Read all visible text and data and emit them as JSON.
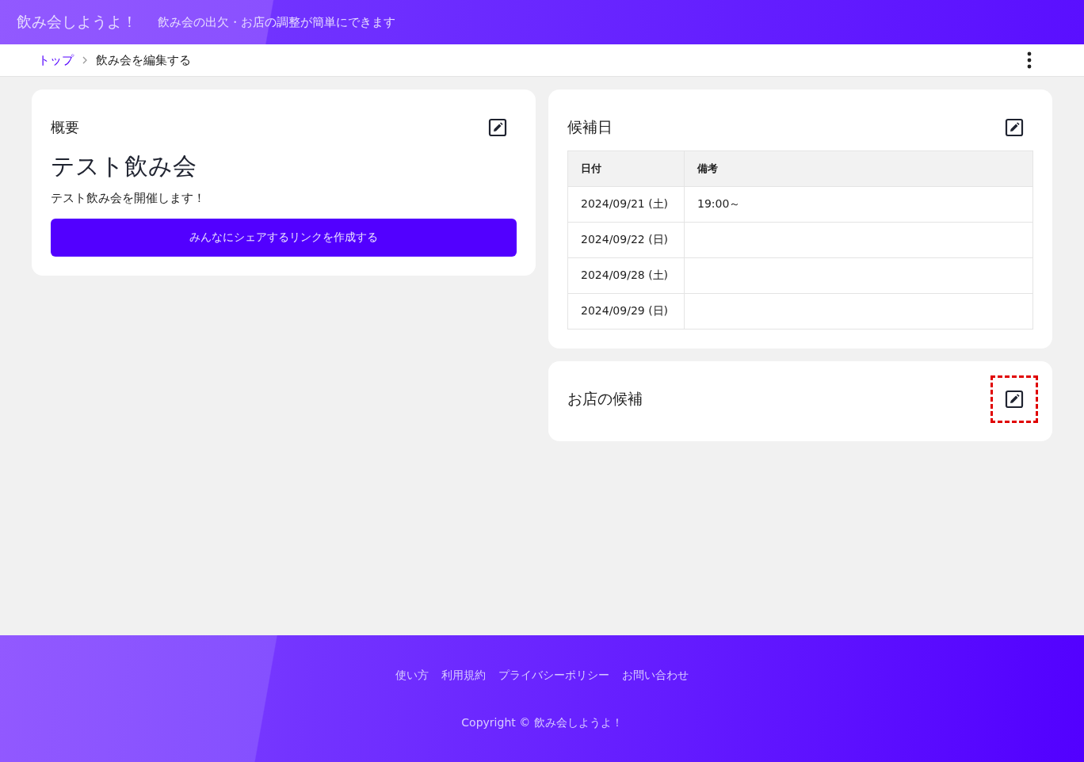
{
  "header": {
    "logo": "飲み会しようよ！",
    "tagline": "飲み会の出欠・お店の調整が簡単にできます"
  },
  "breadcrumb": [
    {
      "label": "トップ",
      "link": true
    },
    {
      "label": "飲み会を編集する",
      "link": false
    }
  ],
  "overview": {
    "title": "概要",
    "highlighted": false,
    "event_name": "テスト飲み会",
    "description": "テスト飲み会を開催します！",
    "share_button": "みんなにシェアするリンクを作成する"
  },
  "candidate_dates": {
    "title": "候補日",
    "highlighted": false,
    "columns": [
      "日付",
      "備考"
    ],
    "rows": [
      {
        "date": "2024/09/21 (土)",
        "note": "19:00～"
      },
      {
        "date": "2024/09/22 (日)",
        "note": ""
      },
      {
        "date": "2024/09/28 (土)",
        "note": ""
      },
      {
        "date": "2024/09/29 (日)",
        "note": ""
      }
    ]
  },
  "shops": {
    "title": "お店の候補",
    "highlighted": true
  },
  "footer": {
    "links": [
      "使い方",
      "利用規約",
      "プライバシーポリシー",
      "お問い合わせ"
    ],
    "copyright": "Copyright © 飲み会しようよ！"
  }
}
